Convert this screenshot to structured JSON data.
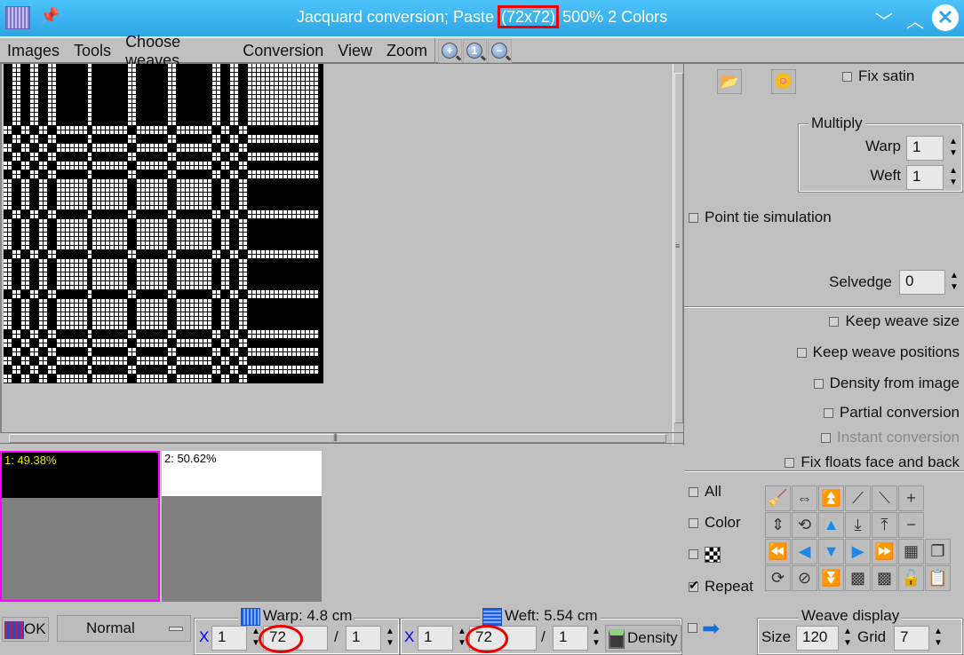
{
  "window": {
    "title_prefix": "Jacquard conversion; Paste",
    "title_size": "(72x72)",
    "title_suffix": "500% 2 Colors",
    "minimize": "﹀",
    "maximize": "︿",
    "close": "✕"
  },
  "menu": {
    "items": [
      "Images",
      "Tools",
      "Choose weaves",
      "Conversion",
      "View",
      "Zoom"
    ],
    "zoom_in": "+",
    "zoom_reset": "1",
    "zoom_out": "−"
  },
  "weave": {
    "size": [
      72,
      72
    ],
    "colors": {
      "fg": "#ffffff",
      "bg": "#000000"
    },
    "col_kinds": "bbaabbaabbaabbbbbbbabbbbbbbbaabbbbbbbaabbbbbbbbaabbaabbaaaaaaaaaaaaaaaa",
    "row_kinds": "aaaaaaaaaaaaaabbaabbaabbaabbbbbbbaabbbbbbbaabbbbbbbaabbbbbbbaabbaabbaabb"
  },
  "colors_panel": {
    "swatches": [
      {
        "label": "1: 49.38%",
        "color": "#000000",
        "label_color": "#e8e800",
        "selected": true
      },
      {
        "label": "2: 50.62%",
        "color": "#ffffff",
        "label_color": "#000000",
        "selected": false
      }
    ]
  },
  "right": {
    "fix_satin": "Fix satin",
    "multiply": {
      "title": "Multiply",
      "warp_label": "Warp",
      "warp_value": "1",
      "weft_label": "Weft",
      "weft_value": "1"
    },
    "point_tie": "Point tie simulation",
    "selvedge_label": "Selvedge",
    "selvedge_value": "0",
    "options": [
      {
        "label": "Keep weave size",
        "checked": false,
        "enabled": true
      },
      {
        "label": "Keep weave positions",
        "checked": false,
        "enabled": true
      },
      {
        "label": "Density from image",
        "checked": false,
        "enabled": true
      },
      {
        "label": "Partial conversion",
        "checked": false,
        "enabled": true
      },
      {
        "label": "Instant conversion",
        "checked": false,
        "enabled": false
      },
      {
        "label": "Fix floats face and back",
        "checked": false,
        "enabled": true
      }
    ],
    "all": "All",
    "color": "Color",
    "repeat": "Repeat",
    "tools": [
      [
        "broom-icon",
        "flip-horizontal-icon",
        "double-up-arrow-icon",
        "shift-right-up-icon",
        "shift-left-up-icon",
        "plus-icon"
      ],
      [
        "flip-vertical-icon",
        "rotate-icon",
        "up-arrow-icon",
        "shift-down-icon",
        "shift-up-icon",
        "minus-icon"
      ],
      [
        "double-left-arrow-icon",
        "left-arrow-icon",
        "down-arrow-icon",
        "right-arrow-icon",
        "double-right-arrow-icon",
        "grid-pattern-icon",
        "copy-icon"
      ],
      [
        "refresh-icon",
        "invert-icon",
        "double-down-arrow-icon",
        "import-weave-icon",
        "export-weave-icon",
        "unlock-icon",
        "paste-icon"
      ]
    ],
    "tool_glyphs": [
      [
        "🧹",
        "⇔",
        "⏫",
        "⟋",
        "⟍",
        "+"
      ],
      [
        "⇕",
        "⟲",
        "▲",
        "⤓",
        "⤒",
        "−"
      ],
      [
        "⏪",
        "◀",
        "▼",
        "▶",
        "⏩",
        "▦",
        "❐"
      ],
      [
        "⟳",
        "⊘",
        "⏬",
        "▩",
        "▩",
        "🔓",
        "📋"
      ]
    ]
  },
  "bottom": {
    "ok": "OK",
    "mode": "Normal",
    "warp": {
      "title": "Warp: 4.8 cm",
      "x": "X",
      "mult": "1",
      "value": "72",
      "div_sep": "/",
      "div": "1"
    },
    "weft": {
      "title": "Weft: 5.54 cm",
      "x": "X",
      "mult": "1",
      "value": "72",
      "div_sep": "/",
      "div": "1"
    },
    "density": "Density",
    "weave_display": {
      "title": "Weave display",
      "size_label": "Size",
      "size_value": "120",
      "grid_label": "Grid",
      "grid_value": "7"
    }
  }
}
